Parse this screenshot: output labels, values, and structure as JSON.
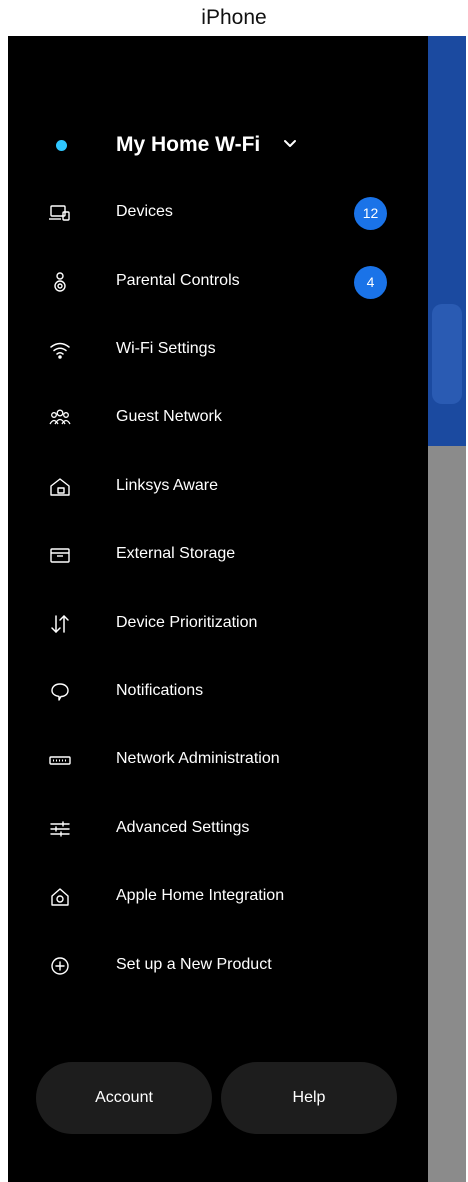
{
  "device_label": "iPhone",
  "network": {
    "name": "My Home W-Fi",
    "status_color": "#2fc7ff"
  },
  "menu": {
    "items": [
      {
        "label": "Devices",
        "icon": "devices-icon",
        "badge": "12"
      },
      {
        "label": "Parental Controls",
        "icon": "parental-controls-icon",
        "badge": "4"
      },
      {
        "label": "Wi-Fi Settings",
        "icon": "wifi-icon"
      },
      {
        "label": "Guest Network",
        "icon": "guest-network-icon"
      },
      {
        "label": "Linksys Aware",
        "icon": "home-icon"
      },
      {
        "label": "External Storage",
        "icon": "storage-icon"
      },
      {
        "label": "Device Prioritization",
        "icon": "prioritization-arrows-icon"
      },
      {
        "label": "Notifications",
        "icon": "notification-bubble-icon"
      },
      {
        "label": "Network Administration",
        "icon": "router-icon"
      },
      {
        "label": "Advanced Settings",
        "icon": "sliders-icon"
      },
      {
        "label": "Apple Home Integration",
        "icon": "apple-home-icon"
      },
      {
        "label": "Set up a New Product",
        "icon": "add-circle-icon"
      }
    ]
  },
  "footer": {
    "account_label": "Account",
    "help_label": "Help"
  },
  "colors": {
    "badge": "#1a73e8",
    "drawer_background": "#000000",
    "pill_background": "#1d1d1d"
  }
}
